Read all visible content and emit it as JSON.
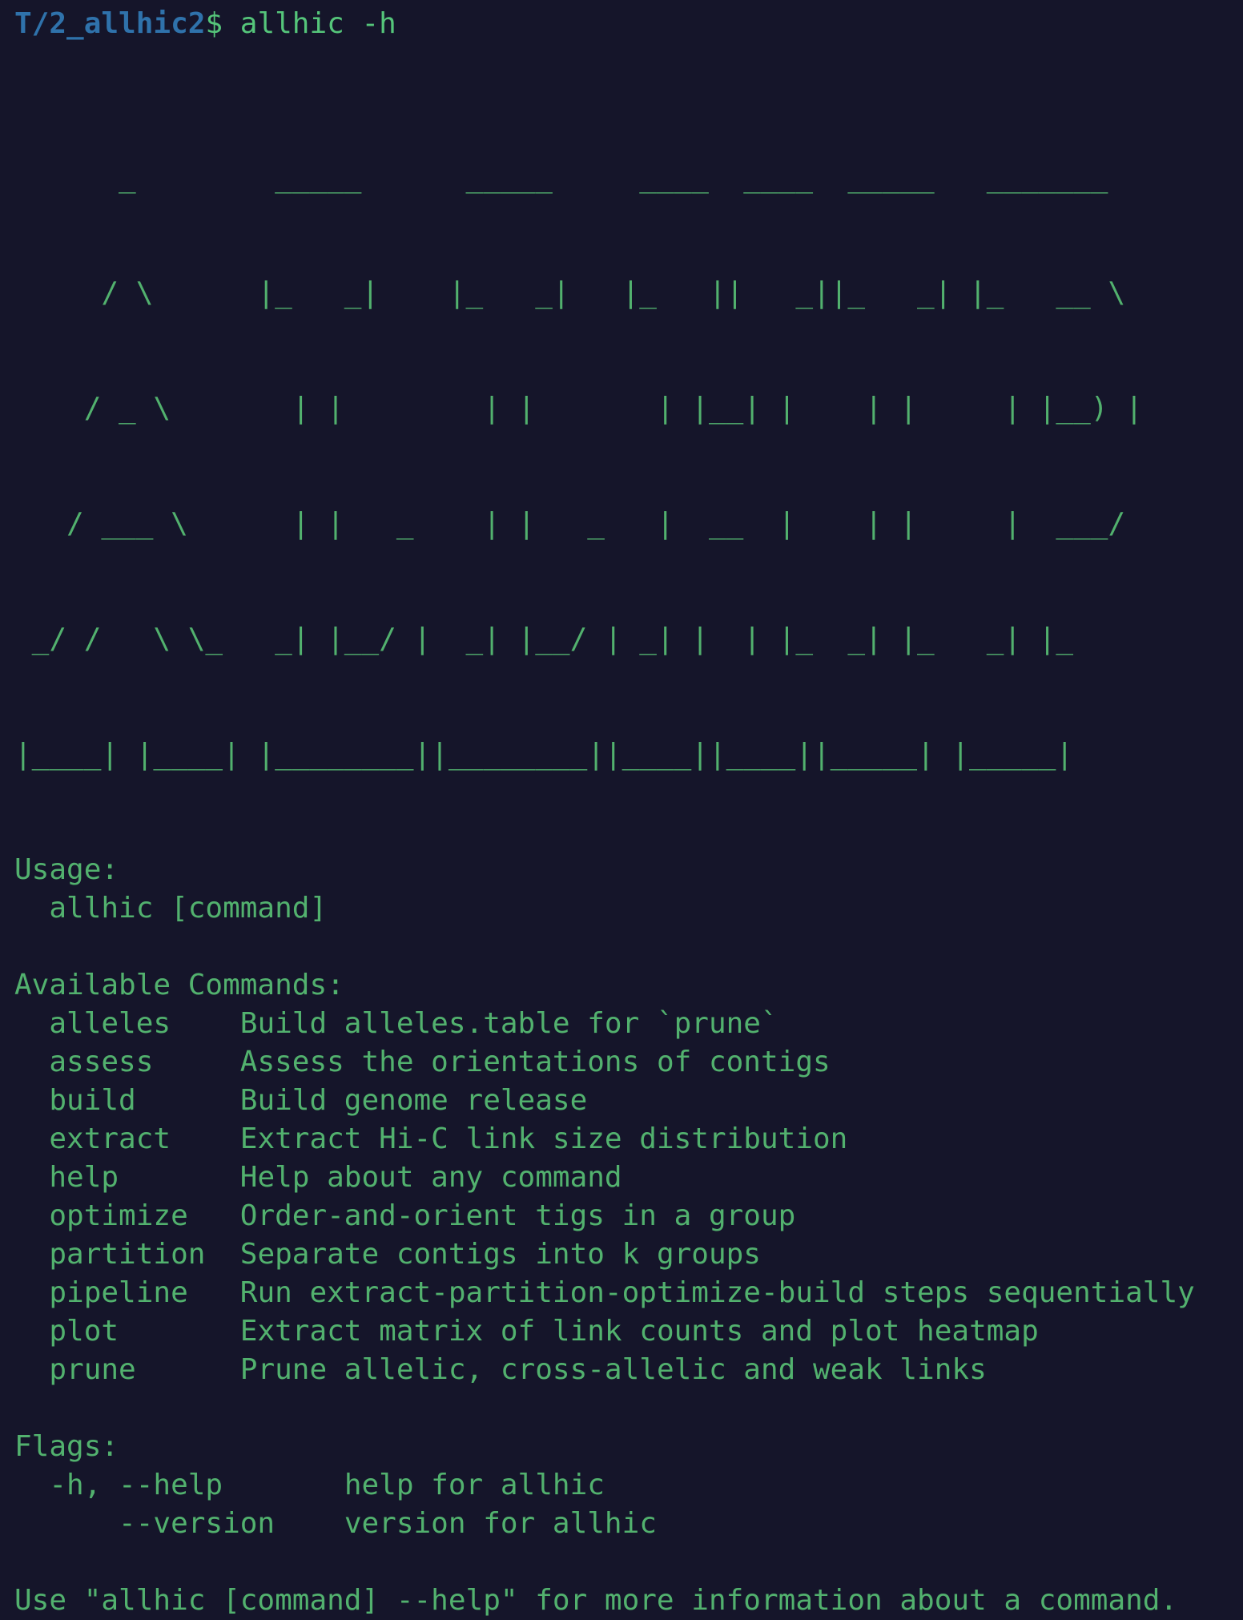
{
  "terminal": {
    "background_color": "#15152a",
    "text_color": "#52b16e",
    "prompt_color": "#2f72ab",
    "command_color": "#55c57a"
  },
  "prompt": {
    "path": "T/2_allhic2",
    "symbol": "$",
    "command": " allhic -h"
  },
  "banner": {
    "alt": "ALLHIC ascii art logo",
    "rows": [
      "      _        _____      _____     ____  ____  _____   _______",
      "     / \\      |_   _|    |_   _|   |_   ||   _||_   _| |_   __ \\",
      "    / _ \\       | |        | |       | |__| |    | |     | |__) |",
      "   / ___ \\      | |   _    | |   _   |  __  |    | |     |  ___/",
      " _/ /   \\ \\_   _| |__/ |  _| |__/ | _| |  | |_  _| |_   _| |_",
      "|____| |____| |________||________||____||____||_____| |_____|"
    ]
  },
  "usage": {
    "heading": "Usage:",
    "line": "  allhic [command]"
  },
  "available_commands": {
    "heading": "Available Commands:",
    "items": [
      {
        "name": "alleles",
        "description": "Build alleles.table for `prune`"
      },
      {
        "name": "assess",
        "description": "Assess the orientations of contigs"
      },
      {
        "name": "build",
        "description": "Build genome release"
      },
      {
        "name": "extract",
        "description": "Extract Hi-C link size distribution"
      },
      {
        "name": "help",
        "description": "Help about any command"
      },
      {
        "name": "optimize",
        "description": "Order-and-orient tigs in a group"
      },
      {
        "name": "partition",
        "description": "Separate contigs into k groups"
      },
      {
        "name": "pipeline",
        "description": "Run extract-partition-optimize-build steps sequentially"
      },
      {
        "name": "plot",
        "description": "Extract matrix of link counts and plot heatmap"
      },
      {
        "name": "prune",
        "description": "Prune allelic, cross-allelic and weak links"
      }
    ]
  },
  "flags": {
    "heading": "Flags:",
    "items": [
      {
        "flag": "  -h, --help",
        "description": "help for allhic"
      },
      {
        "flag": "      --version",
        "description": "version for allhic"
      }
    ]
  },
  "footer": {
    "text": "Use \"allhic [command] --help\" for more information about a command."
  }
}
